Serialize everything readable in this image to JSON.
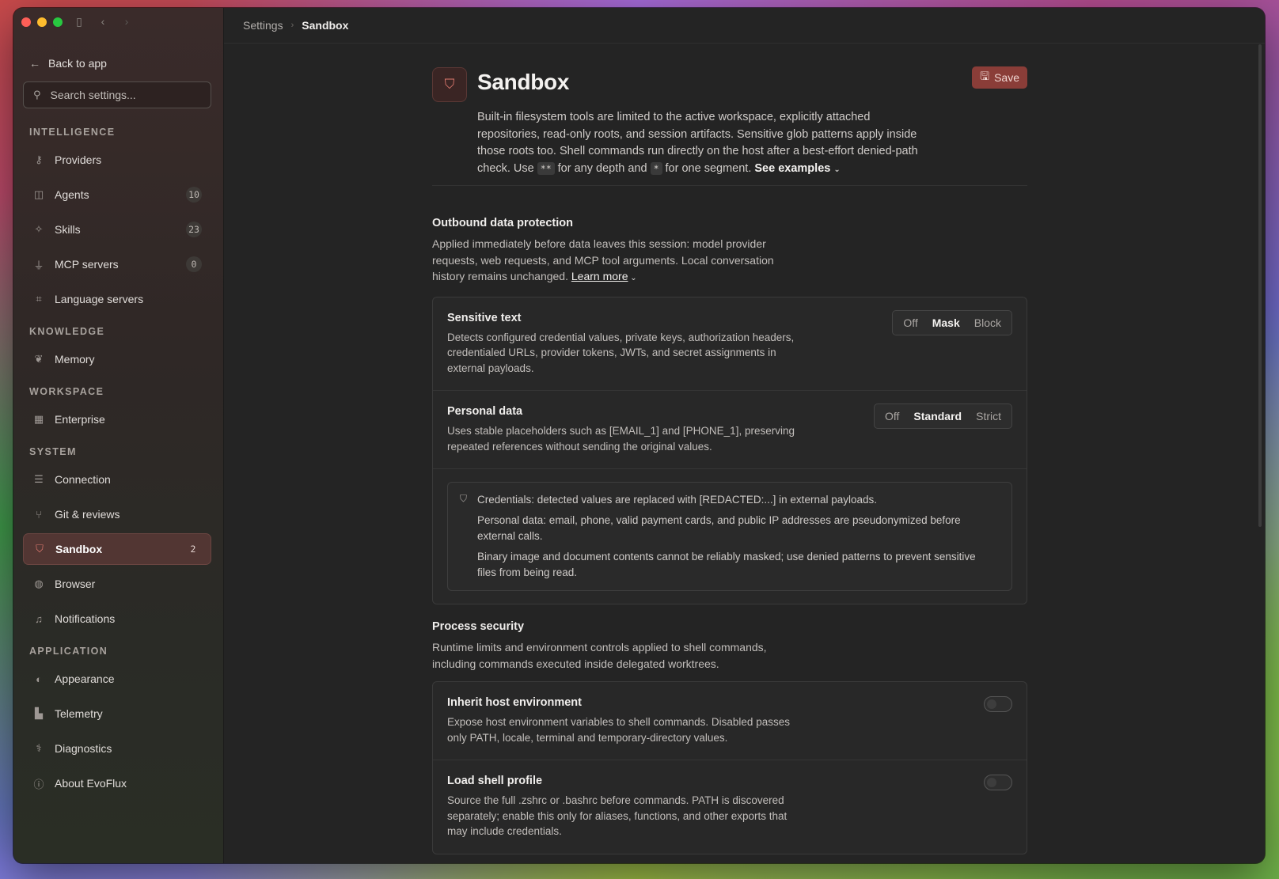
{
  "breadcrumb": {
    "root": "Settings",
    "current": "Sandbox"
  },
  "sidebar": {
    "back_label": "Back to app",
    "search_placeholder": "Search settings...",
    "sections": {
      "intelligence": "INTELLIGENCE",
      "knowledge": "KNOWLEDGE",
      "workspace": "WORKSPACE",
      "system": "SYSTEM",
      "application": "APPLICATION"
    },
    "items": {
      "providers": {
        "label": "Providers",
        "icon": "key-icon"
      },
      "agents": {
        "label": "Agents",
        "badge": "10",
        "icon": "robot-icon"
      },
      "skills": {
        "label": "Skills",
        "badge": "23",
        "icon": "sparkle-icon"
      },
      "mcp": {
        "label": "MCP servers",
        "badge": "0",
        "icon": "plug-icon"
      },
      "language": {
        "label": "Language servers",
        "icon": "code-icon"
      },
      "memory": {
        "label": "Memory",
        "icon": "brain-icon"
      },
      "enterprise": {
        "label": "Enterprise",
        "icon": "building-icon"
      },
      "connection": {
        "label": "Connection",
        "icon": "server-icon"
      },
      "git": {
        "label": "Git & reviews",
        "icon": "git-branch-icon"
      },
      "sandbox": {
        "label": "Sandbox",
        "badge": "2",
        "icon": "shield-icon"
      },
      "browser": {
        "label": "Browser",
        "icon": "globe-icon"
      },
      "notifications": {
        "label": "Notifications",
        "icon": "bell-icon"
      },
      "appearance": {
        "label": "Appearance",
        "icon": "palette-icon"
      },
      "telemetry": {
        "label": "Telemetry",
        "icon": "bar-chart-icon"
      },
      "diagnostics": {
        "label": "Diagnostics",
        "icon": "stethoscope-icon"
      },
      "about": {
        "label": "About EvoFlux",
        "icon": "info-icon"
      }
    }
  },
  "page": {
    "title": "Sandbox",
    "save_label": "Save",
    "desc_part1": "Built-in filesystem tools are limited to the active workspace, explicitly attached repositories, read-only roots, and session artifacts. Sensitive glob patterns apply inside those roots too. Shell commands run directly on the host after a best-effort denied-path check. Use",
    "code_double_star": "**",
    "desc_part2": "for any depth and",
    "code_star": "*",
    "desc_part3": "for one segment.",
    "see_examples": "See examples"
  },
  "outbound": {
    "title": "Outbound data protection",
    "desc": "Applied immediately before data leaves this session: model provider requests, web requests, and MCP tool arguments. Local conversation history remains unchanged.",
    "learn_more": "Learn more",
    "sensitive": {
      "title": "Sensitive text",
      "desc": "Detects configured credential values, private keys, authorization headers, credentialed URLs, provider tokens, JWTs, and secret assignments in external payloads.",
      "options": [
        "Off",
        "Mask",
        "Block"
      ],
      "selected": "Mask"
    },
    "personal": {
      "title": "Personal data",
      "desc": "Uses stable placeholders such as [EMAIL_1] and [PHONE_1], preserving repeated references without sending the original values.",
      "options": [
        "Off",
        "Standard",
        "Strict"
      ],
      "selected": "Standard"
    },
    "notes": [
      "Credentials: detected values are replaced with [REDACTED:...] in external payloads.",
      "Personal data: email, phone, valid payment cards, and public IP addresses are pseudonymized before external calls.",
      "Binary image and document contents cannot be reliably masked; use denied patterns to prevent sensitive files from being read."
    ]
  },
  "process": {
    "title": "Process security",
    "desc": "Runtime limits and environment controls applied to shell commands, including commands executed inside delegated worktrees.",
    "inherit": {
      "title": "Inherit host environment",
      "desc": "Expose host environment variables to shell commands. Disabled passes only PATH, locale, terminal and temporary-directory values.",
      "enabled": false
    },
    "shell_profile": {
      "title": "Load shell profile",
      "desc": "Source the full .zshrc or .bashrc before commands. PATH is discovered separately; enable this only for aliases, functions, and other exports that may include credentials.",
      "enabled": false
    }
  },
  "colors": {
    "accent": "#e07a70",
    "active_bg": "#523633",
    "save_bg": "#8a3d38"
  }
}
